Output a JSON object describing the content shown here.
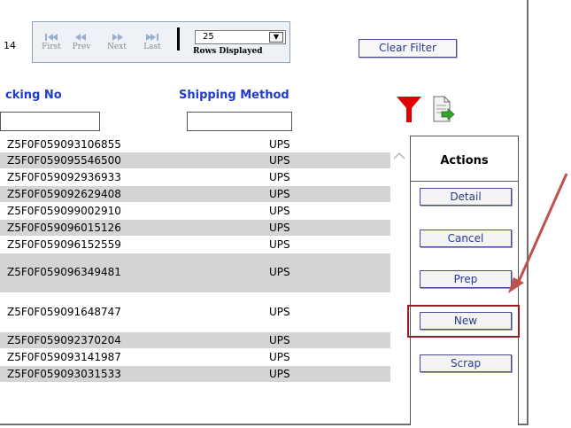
{
  "pager": {
    "page_count_text": "14",
    "first_label": "First",
    "prev_label": "Prev",
    "next_label": "Next",
    "last_label": "Last",
    "rows_value": "25",
    "rows_label": "Rows Displayed"
  },
  "toolbar": {
    "clear_filter_label": "Clear Filter"
  },
  "columns": {
    "tracking_header": "cking No",
    "shipping_header": "Shipping Method"
  },
  "icons": {
    "filter": "filter-funnel-icon",
    "export": "export-icon",
    "scroll_up": "chevron-up-icon"
  },
  "colors": {
    "header_blue": "#1f3ccf",
    "filter_red": "#e00000",
    "highlight": "#9b1c1c",
    "row_shade": "#d4d4d4"
  },
  "rows": [
    {
      "tracking": "Z5F0F059093106855",
      "shipping": "UPS"
    },
    {
      "tracking": "Z5F0F059095546500",
      "shipping": "UPS"
    },
    {
      "tracking": "Z5F0F059092936933",
      "shipping": "UPS"
    },
    {
      "tracking": "Z5F0F059092629408",
      "shipping": "UPS"
    },
    {
      "tracking": "Z5F0F059099002910",
      "shipping": "UPS"
    },
    {
      "tracking": "Z5F0F059096015126",
      "shipping": "UPS"
    },
    {
      "tracking": "Z5F0F059096152559",
      "shipping": "UPS"
    },
    {
      "tracking": "Z5F0F059096349481",
      "shipping": "UPS"
    },
    {
      "tracking": "Z5F0F059091648747",
      "shipping": "UPS"
    },
    {
      "tracking": "Z5F0F059092370204",
      "shipping": "UPS"
    },
    {
      "tracking": "Z5F0F059093141987",
      "shipping": "UPS"
    },
    {
      "tracking": "Z5F0F059093031533",
      "shipping": "UPS"
    }
  ],
  "actions": {
    "header": "Actions",
    "detail": "Detail",
    "cancel": "Cancel",
    "prep": "Prep",
    "new": "New",
    "scrap": "Scrap"
  }
}
